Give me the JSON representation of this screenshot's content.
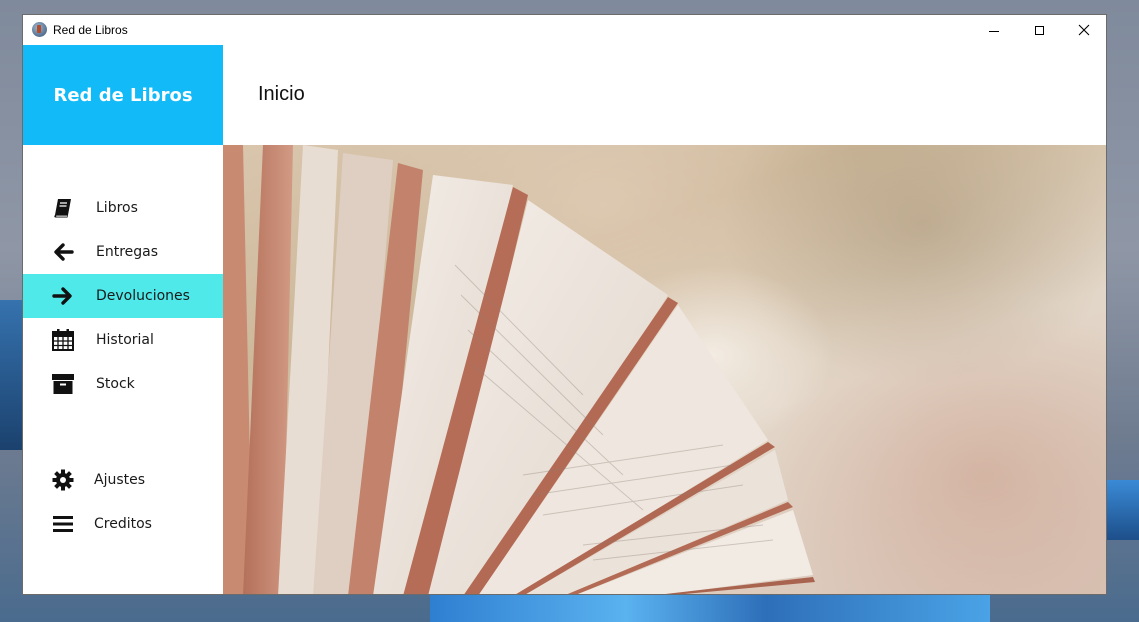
{
  "window": {
    "title": "Red de Libros",
    "controls": [
      "minimize",
      "maximize",
      "close"
    ]
  },
  "sidebar": {
    "brand": "Red de Libros",
    "brand_color": "#12baf7",
    "active_color": "#4fe9ea",
    "items": [
      {
        "label": "Libros",
        "icon": "book-icon",
        "active": false
      },
      {
        "label": "Entregas",
        "icon": "arrow-left-icon",
        "active": false
      },
      {
        "label": "Devoluciones",
        "icon": "arrow-right-icon",
        "active": true
      },
      {
        "label": "Historial",
        "icon": "calendar-icon",
        "active": false
      },
      {
        "label": "Stock",
        "icon": "archive-box-icon",
        "active": false
      }
    ],
    "bottom_items": [
      {
        "label": "Ajustes",
        "icon": "gear-icon"
      },
      {
        "label": "Creditos",
        "icon": "menu-bars-icon"
      }
    ]
  },
  "main": {
    "title": "Inicio",
    "hero_image": "open-book-pages-photo"
  }
}
